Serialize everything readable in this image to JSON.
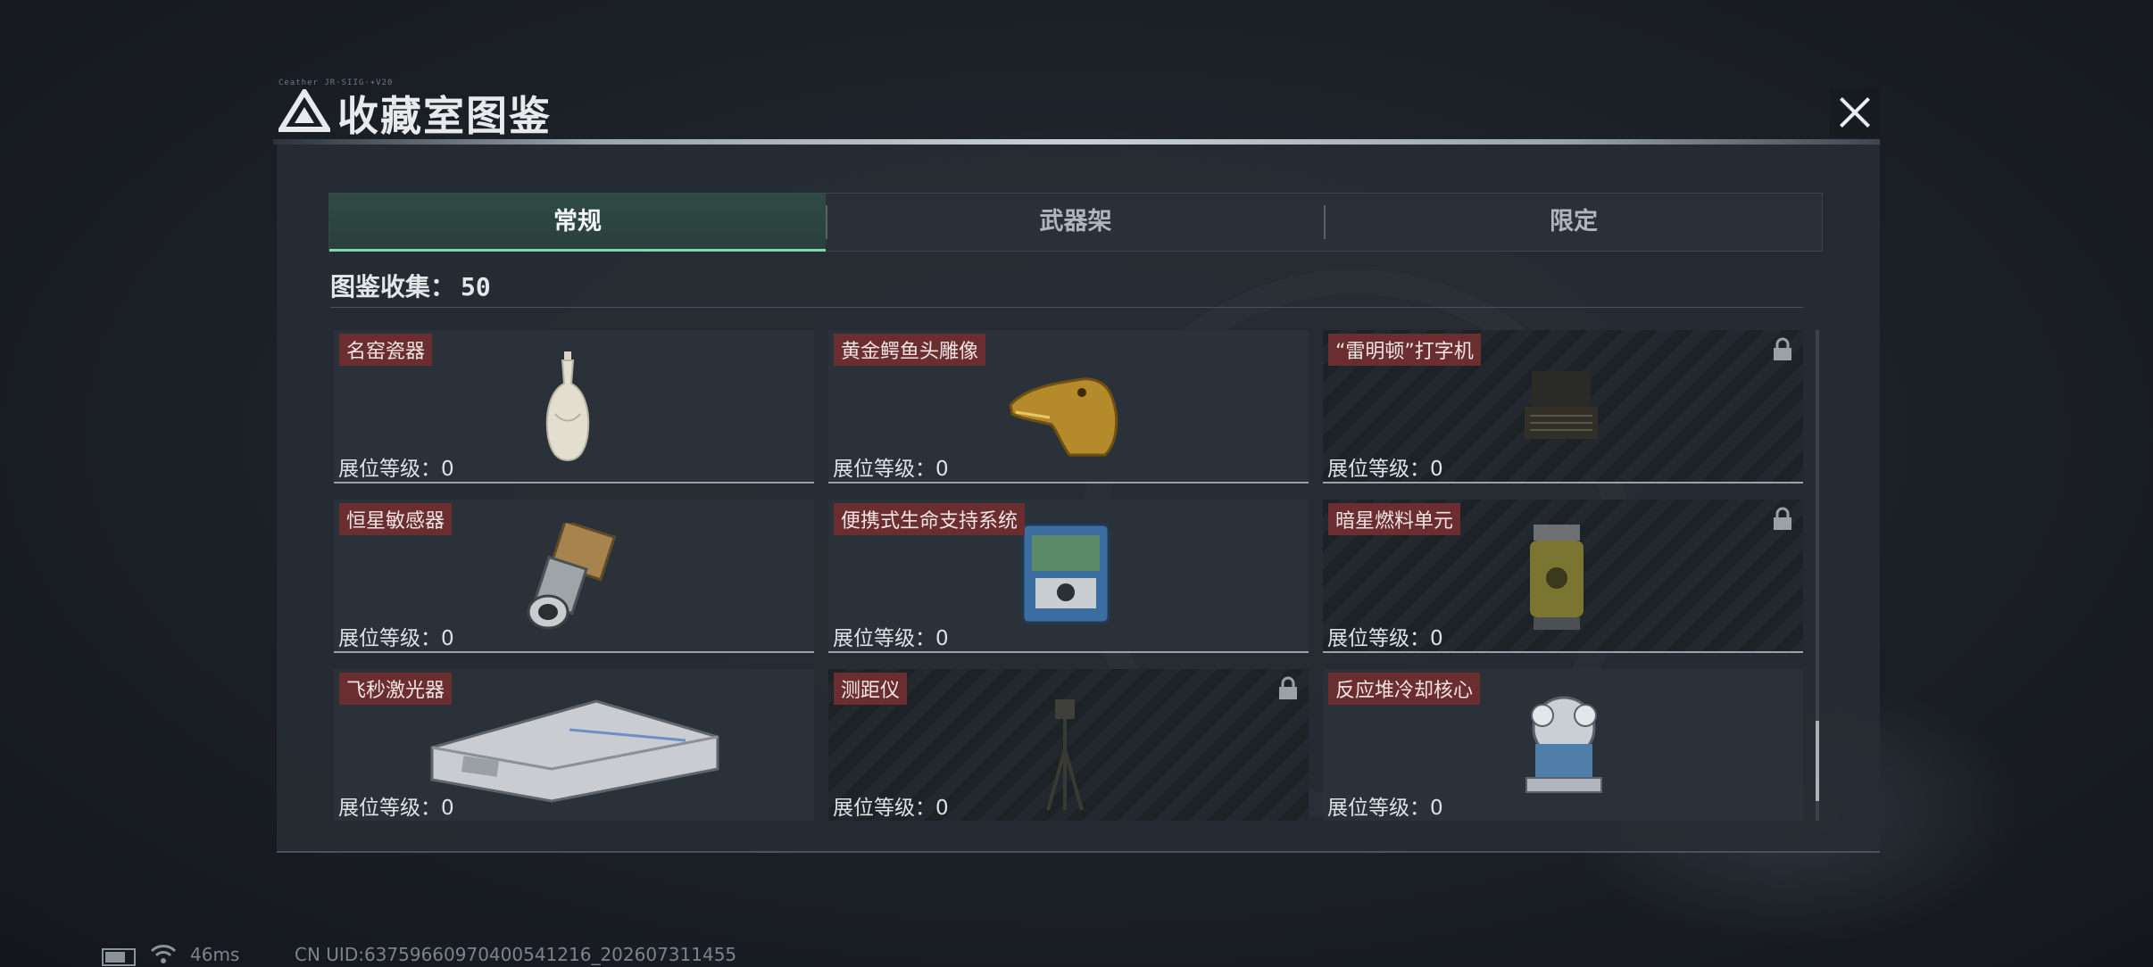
{
  "header": {
    "title": "收藏室图鉴",
    "tiny_text": "Ceather JR·SIIG·+V20",
    "close_label": "×"
  },
  "tabs": [
    {
      "label": "常规",
      "active": true
    },
    {
      "label": "武器架",
      "active": false
    },
    {
      "label": "限定",
      "active": false
    }
  ],
  "collection": {
    "label": "图鉴收集：",
    "count": "50"
  },
  "level_label": "展位等级：",
  "items": [
    {
      "name": "名窑瓷器",
      "level": "0",
      "locked": false,
      "icon": "porcelain-vase-icon"
    },
    {
      "name": "黄金鳄鱼头雕像",
      "level": "0",
      "locked": false,
      "icon": "golden-crocodile-head-icon"
    },
    {
      "name": "“雷明顿”打字机",
      "level": "0",
      "locked": true,
      "icon": "typewriter-icon"
    },
    {
      "name": "恒星敏感器",
      "level": "0",
      "locked": false,
      "icon": "star-sensor-icon"
    },
    {
      "name": "便携式生命支持系统",
      "level": "0",
      "locked": false,
      "icon": "life-support-icon"
    },
    {
      "name": "暗星燃料单元",
      "level": "0",
      "locked": true,
      "icon": "fuel-cell-icon"
    },
    {
      "name": "飞秒激光器",
      "level": "0",
      "locked": false,
      "icon": "femtosecond-laser-icon"
    },
    {
      "name": "测距仪",
      "level": "0",
      "locked": true,
      "icon": "rangefinder-icon"
    },
    {
      "name": "反应堆冷却核心",
      "level": "0",
      "locked": false,
      "icon": "reactor-core-icon"
    }
  ],
  "status": {
    "ping": "46ms",
    "uid": "CN UID:6375966097040054121​6_202607311455"
  },
  "colors": {
    "accent": "#7fd9b0",
    "tag_bg": "#6a2d30",
    "panel_bg": "#262c33"
  }
}
